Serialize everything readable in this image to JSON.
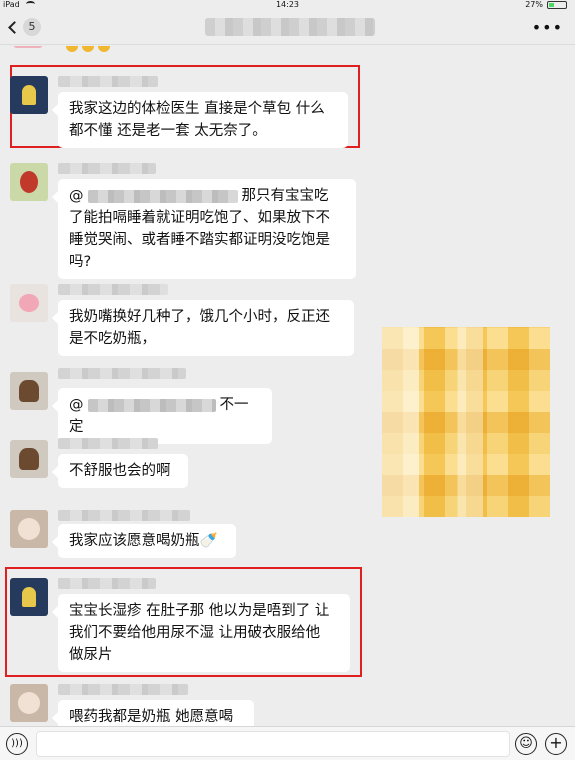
{
  "status_bar": {
    "device": "iPad",
    "time": "14:23",
    "battery": "27%",
    "battery_level": 0.27
  },
  "navbar": {
    "unread_count": "5",
    "more_label": "•••"
  },
  "messages": [
    {
      "lines": [
        "我家这边的体检医生 直接是个草包 什么",
        "都不懂 还是老一套 太无奈了。"
      ],
      "highlighted": true
    },
    {
      "prefix": "@",
      "after_redact": "那只有宝宝吃",
      "lines": [
        "了能拍嗝睡着就证明吃饱了、如果放下不",
        "睡觉哭闹、或者睡不踏实都证明没吃饱是",
        "吗?"
      ]
    },
    {
      "lines": [
        "我奶嘴换好几种了，饿几个小时，反正还",
        "是不吃奶瓶，"
      ]
    },
    {
      "prefix": "@",
      "after_redact": "不一定"
    },
    {
      "lines": [
        "不舒服也会的啊"
      ]
    },
    {
      "lines": [
        "我家应该愿意喝奶瓶"
      ],
      "emoji": "🍼"
    },
    {
      "lines": [
        "宝宝长湿疹 在肚子那 他以为是唔到了 让",
        "我们不要给他用尿不湿 让用破衣服给他",
        "做尿片"
      ],
      "highlighted": true
    },
    {
      "lines": [
        "喂药我都是奶瓶 她愿意喝"
      ]
    }
  ],
  "input_bar": {
    "voice_icon": "voice-icon",
    "emoji_icon": "emoji-icon",
    "plus_icon": "plus-icon"
  }
}
